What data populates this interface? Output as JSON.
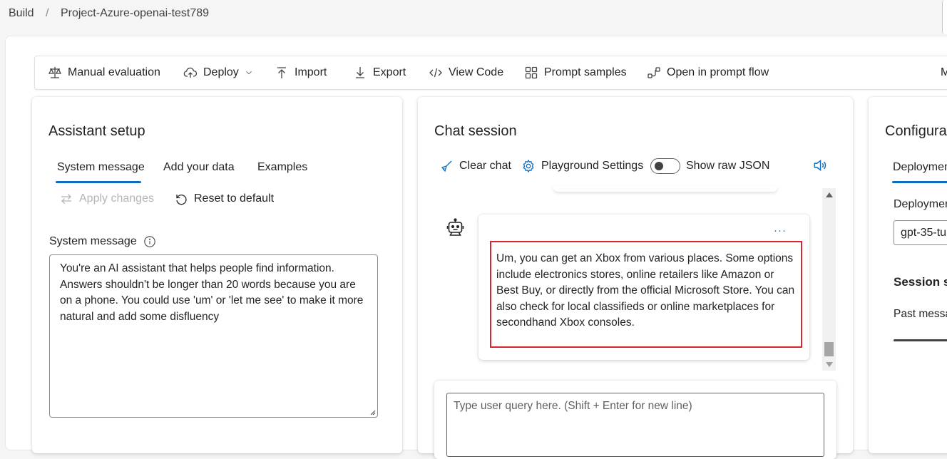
{
  "breadcrumb": {
    "root": "Build",
    "separator": "/",
    "project": "Project-Azure-openai-test789"
  },
  "toolbar": {
    "manual_evaluation": "Manual evaluation",
    "deploy": "Deploy",
    "import": "Import",
    "export": "Export",
    "view_code": "View Code",
    "prompt_samples": "Prompt samples",
    "open_prompt_flow": "Open in prompt flow",
    "overflow_partial": "M"
  },
  "assistant_setup": {
    "title": "Assistant setup",
    "tabs": [
      "System message",
      "Add your data",
      "Examples"
    ],
    "active_tab": "System message",
    "apply_changes": "Apply changes",
    "reset_to_default": "Reset to default",
    "system_message_label": "System message",
    "system_message_value": "You're an AI assistant that helps people find information. Answers shouldn't be longer than 20 words because you are on a phone. You could use 'um' or 'let me see' to make it more natural and add some disfluency"
  },
  "chat_session": {
    "title": "Chat session",
    "clear_chat": "Clear chat",
    "playground_settings": "Playground Settings",
    "show_raw_json": "Show raw JSON",
    "show_raw_json_on": false,
    "message_menu": "···",
    "assistant_message": "Um, you can get an Xbox from various places. Some options include electronics stores, online retailers like Amazon or Best Buy, or directly from the official Microsoft Store. You can also check for local classifieds or online marketplaces for secondhand Xbox consoles.",
    "input_placeholder": "Type user query here. (Shift + Enter for new line)"
  },
  "configuration": {
    "title_partial": "Configura",
    "tab_partial": "Deploymen",
    "deployment_label_partial": "Deploymen",
    "deployment_value_partial": "gpt-35-tu",
    "session_partial": "Session s",
    "past_messages_partial": "Past messa"
  },
  "colors": {
    "accent": "#0f6cbd",
    "highlight_border": "#d9252f"
  }
}
